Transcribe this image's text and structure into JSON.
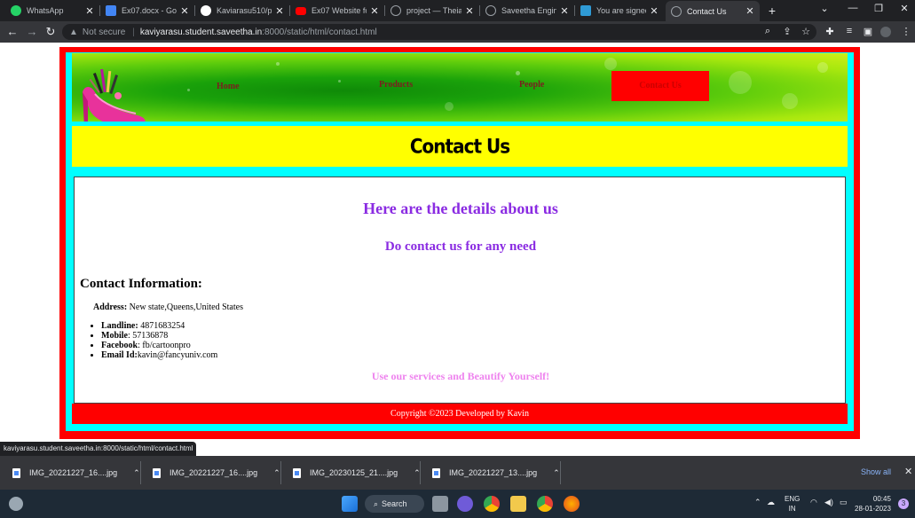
{
  "browser": {
    "tabs": [
      {
        "title": "WhatsApp",
        "icon": "whatsapp-icon",
        "color": "#25d366"
      },
      {
        "title": "Ex07.docx - Goog",
        "icon": "docs-icon",
        "color": "#4285f4"
      },
      {
        "title": "Kaviarasu510/pro",
        "icon": "github-icon",
        "color": "#ffffff"
      },
      {
        "title": "Ex07 Website for",
        "icon": "youtube-icon",
        "color": "#ff0000"
      },
      {
        "title": "project — Theia I",
        "icon": "globe-icon",
        "color": "#9aa0a6"
      },
      {
        "title": "Saveetha Enginee",
        "icon": "globe-icon",
        "color": "#9aa0a6"
      },
      {
        "title": "You are signed in",
        "icon": "s-icon",
        "color": "#2f9bd6"
      },
      {
        "title": "Contact Us",
        "icon": "globe-icon",
        "color": "#9aa0a6"
      }
    ],
    "not_secure": "Not secure",
    "url_host": "kaviyarasu.student.saveetha.in",
    "url_path": ":8000/static/html/contact.html",
    "status_url": "kaviyarasu.student.saveetha.in:8000/static/html/contact.html"
  },
  "site": {
    "nav": [
      "Home",
      "Products",
      "People",
      "Contact Us"
    ],
    "active_nav": "Contact Us",
    "page_title": "Contact Us",
    "heading": "Here are the details about us",
    "subheading": "Do contact us for any need",
    "contact_title": "Contact Information:",
    "address_label": "Address:",
    "address_value": "New state,Queens,United States",
    "contacts": [
      {
        "label": "Landline:",
        "value": "4871683254"
      },
      {
        "label": "Mobile",
        "value": ": 57136878"
      },
      {
        "label": "Facebook",
        "value": ": fb/cartoonpro"
      },
      {
        "label": "Email Id:",
        "value": "kavin@fancyuniv.com"
      }
    ],
    "tagline": "Use our services and Beautify Yourself!",
    "footer": "Copyright ©2023 Developed by Kavin",
    "colors": {
      "outer_border": "#ff0000",
      "inner_border": "#00ffff",
      "title_bar": "#ffff00",
      "heading": "#8a2be2",
      "tagline": "#ee82ee",
      "footer": "#ff0000"
    }
  },
  "downloads": {
    "items": [
      "IMG_20221227_16....jpg",
      "IMG_20221227_16....jpg",
      "IMG_20230125_21....jpg",
      "IMG_20221227_13....jpg"
    ],
    "show_all": "Show all"
  },
  "taskbar": {
    "search_label": "Search",
    "lang_top": "ENG",
    "lang_bottom": "IN",
    "time": "00:45",
    "date": "28-01-2023",
    "notification_count": "3"
  }
}
